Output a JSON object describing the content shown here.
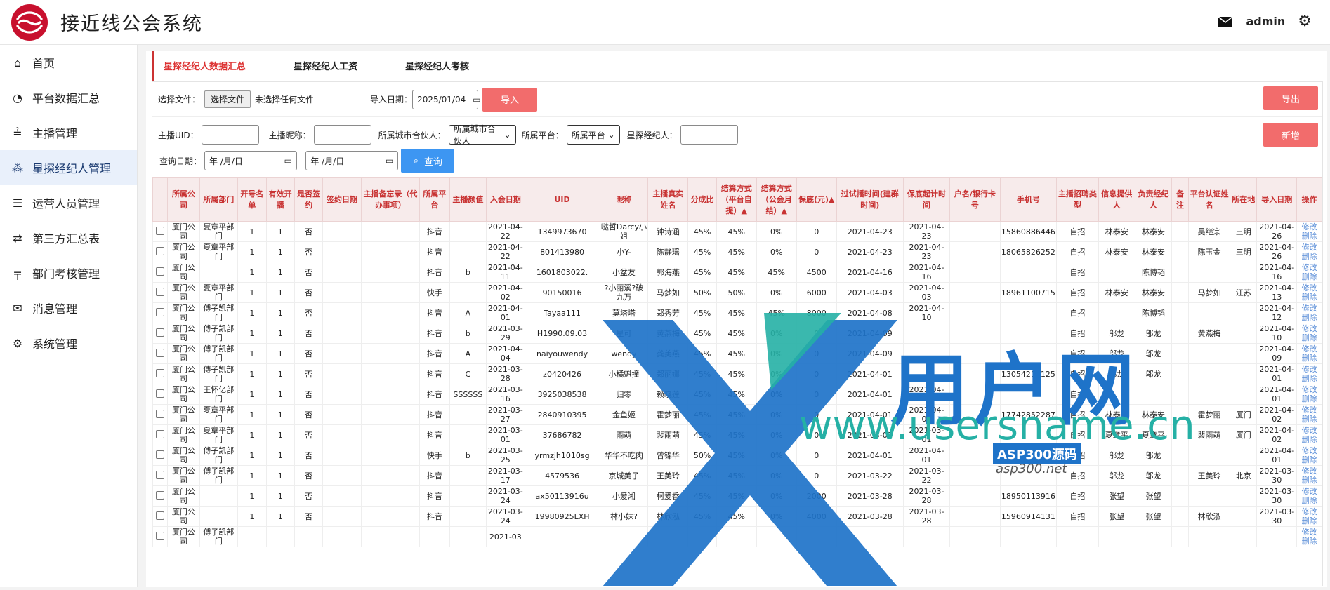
{
  "app": {
    "title": "接近线公会系统",
    "user": "admin"
  },
  "sidebar": {
    "items": [
      {
        "label": "首页",
        "icon": "home-icon",
        "glyph": "⌂"
      },
      {
        "label": "平台数据汇总",
        "icon": "dashboard-icon",
        "glyph": "◔"
      },
      {
        "label": "主播管理",
        "icon": "sliders-icon",
        "glyph": "≟"
      },
      {
        "label": "星探经纪人管理",
        "icon": "users-icon",
        "glyph": "⁂"
      },
      {
        "label": "运营人员管理",
        "icon": "list-icon",
        "glyph": "☰"
      },
      {
        "label": "第三方汇总表",
        "icon": "shuffle-icon",
        "glyph": "⇄"
      },
      {
        "label": "部门考核管理",
        "icon": "org-icon",
        "glyph": "╤"
      },
      {
        "label": "消息管理",
        "icon": "envelope-icon",
        "glyph": "✉"
      },
      {
        "label": "系统管理",
        "icon": "gear-icon",
        "glyph": "⚙"
      }
    ]
  },
  "tabs": [
    "星探经纪人数据汇总",
    "星探经纪人工资",
    "星探经纪人考核"
  ],
  "toolbar": {
    "file_label": "选择文件：",
    "file_button": "选择文件",
    "no_file": "未选择任何文件",
    "import_date_label": "导入日期：",
    "import_date": "2025/01/04",
    "import_button": "导入",
    "export_button": "导出",
    "host_uid_label": "主播UID：",
    "host_nick_label": "主播昵称：",
    "city_partner_label": "所属城市合伙人：",
    "city_partner_value": "所属城市合伙人",
    "platform_label": "所属平台：",
    "platform_value": "所属平台",
    "scout_label": "星探经纪人：",
    "add_button": "新增",
    "query_date_label": "查询日期：",
    "date_placeholder": "年 /月/日",
    "date_sep": "-",
    "query_button": "查询"
  },
  "table": {
    "headers": [
      "",
      "所属公司",
      "所属部门",
      "开号名单",
      "有效开播",
      "是否签约",
      "签约日期",
      "主播备忘录（代办事项）",
      "所属平台",
      "主播颜值",
      "入会日期",
      "UID",
      "昵称",
      "主播真实姓名",
      "分成比",
      "结算方式（平台自提）▲",
      "结算方式（公会月结）▲",
      "保底(元)▲",
      "过试播时间(建群时间)",
      "保底起计时间",
      "户名/银行卡号",
      "手机号",
      "主播招聘类型",
      "信息提供人",
      "负责经纪人",
      "备注",
      "平台认证姓名",
      "所在地",
      "导入日期",
      "操作"
    ],
    "action_edit": "修改",
    "action_delete": "删除",
    "rows": [
      [
        "厦门公司",
        "夏章平部门",
        "1",
        "1",
        "否",
        "",
        "",
        "抖音",
        "",
        "2021-04-22",
        "1349973670",
        "哒哲Darcy小姐",
        "钟诗涵",
        "45%",
        "45%",
        "0%",
        "0",
        "2021-04-23",
        "2021-04-23",
        "",
        "15860886446",
        "自招",
        "林泰安",
        "林泰安",
        "",
        "吴继宗",
        "三明",
        "2021-04-26"
      ],
      [
        "厦门公司",
        "夏章平部门",
        "1",
        "1",
        "否",
        "",
        "",
        "抖音",
        "",
        "2021-04-22",
        "801413980",
        "小Y-",
        "陈静瑶",
        "45%",
        "45%",
        "0%",
        "0",
        "2021-04-23",
        "2021-04-23",
        "",
        "18065826252",
        "自招",
        "林泰安",
        "林泰安",
        "",
        "陈玉金",
        "三明",
        "2021-04-26"
      ],
      [
        "厦门公司",
        "",
        "1",
        "1",
        "否",
        "",
        "",
        "抖音",
        "b",
        "2021-04-11",
        "1601803022.",
        "小盆友",
        "郭海燕",
        "45%",
        "45%",
        "45%",
        "4500",
        "2021-04-16",
        "2021-04-16",
        "",
        "",
        "自招",
        "",
        "陈博韬",
        "",
        "",
        "",
        "2021-04-16"
      ],
      [
        "厦门公司",
        "夏章平部门",
        "1",
        "1",
        "否",
        "",
        "",
        "快手",
        "",
        "2021-04-02",
        "90150016",
        "?小丽溪?破九万",
        "马梦如",
        "50%",
        "50%",
        "0%",
        "6000",
        "2021-04-03",
        "2021-04-03",
        "",
        "18961100715",
        "自招",
        "林泰安",
        "林泰安",
        "",
        "马梦如",
        "江苏",
        "2021-04-13"
      ],
      [
        "厦门公司",
        "傅子凯部门",
        "1",
        "1",
        "否",
        "",
        "",
        "抖音",
        "A",
        "2021-04-01",
        "Tayaa111",
        "莫塔塔",
        "郑秀芳",
        "45%",
        "45%",
        "45%",
        "8000",
        "2021-04-08",
        "2021-04-10",
        "",
        "",
        "自招",
        "",
        "陈博韬",
        "",
        "",
        "",
        "2021-04-12"
      ],
      [
        "厦门公司",
        "傅子凯部门",
        "1",
        "1",
        "否",
        "",
        "",
        "抖音",
        "b",
        "2021-03-29",
        "H1990.09.03",
        "星可",
        "黄燕梅",
        "45%",
        "45%",
        "0%",
        "0",
        "2021-04-09",
        "",
        "",
        "",
        "自招",
        "邬龙",
        "邬龙",
        "",
        "黄燕梅",
        "",
        "2021-04-10"
      ],
      [
        "厦门公司",
        "傅子凯部门",
        "1",
        "1",
        "否",
        "",
        "",
        "抖音",
        "A",
        "2021-04-04",
        "naiyouwendy",
        "wendy",
        "龚美燕",
        "45%",
        "45%",
        "0%",
        "0",
        "2021-04-09",
        "",
        "",
        "",
        "自招",
        "邬龙",
        "邬龙",
        "",
        "",
        "",
        "2021-04-09"
      ],
      [
        "厦门公司",
        "傅子凯部门",
        "1",
        "1",
        "否",
        "",
        "",
        "抖音",
        "C",
        "2021-03-28",
        "z0420426",
        "小橘魁撞",
        "郑丽娜",
        "45%",
        "45%",
        "0%",
        "0",
        "2021-04-01",
        "",
        "",
        "13054212125",
        "自招",
        "邬龙",
        "邬龙",
        "",
        "",
        "",
        "2021-04-01"
      ],
      [
        "厦门公司",
        "王怀亿部门",
        "1",
        "1",
        "否",
        "",
        "",
        "抖音",
        "SSSSSS",
        "2021-03-16",
        "3925038538",
        "归零",
        "赖晓莲",
        "45%",
        "45%",
        "0%",
        "0",
        "2021-04-01",
        "2021-04-01",
        "",
        "",
        "自招",
        "",
        "",
        "",
        "",
        "",
        "2021-04-01"
      ],
      [
        "厦门公司",
        "夏章平部门",
        "1",
        "1",
        "否",
        "",
        "",
        "抖音",
        "",
        "2021-03-27",
        "2840910395",
        "金鱼姬",
        "霍梦丽",
        "45%",
        "45%",
        "0%",
        "0",
        "2021-04-01",
        "2021-04-01",
        "",
        "17742852287",
        "自招",
        "林泰安",
        "林泰安",
        "",
        "霍梦丽",
        "厦门",
        "2021-04-02"
      ],
      [
        "厦门公司",
        "夏章平部门",
        "1",
        "1",
        "否",
        "",
        "",
        "抖音",
        "",
        "2021-03-01",
        "37686782",
        "雨萌",
        "裴雨萌",
        "45%",
        "45%",
        "0%",
        "0",
        "2021-03-01",
        "2021-03-01",
        "",
        "",
        "自招",
        "夏章平",
        "夏章平",
        "",
        "裴雨萌",
        "厦门",
        "2021-04-02"
      ],
      [
        "厦门公司",
        "傅子凯部门",
        "1",
        "1",
        "否",
        "",
        "",
        "快手",
        "b",
        "2021-03-25",
        "yrmzjh1010sg",
        "华华不吃肉",
        "曾锦华",
        "50%",
        "45%",
        "0%",
        "0",
        "2021-04-01",
        "2021-04-01",
        "",
        "",
        "自招",
        "邬龙",
        "邬龙",
        "",
        "",
        "",
        "2021-04-01"
      ],
      [
        "厦门公司",
        "傅子凯部门",
        "1",
        "1",
        "否",
        "",
        "",
        "抖音",
        "",
        "2021-03-17",
        "4579536",
        "京城美子",
        "王美玲",
        "45%",
        "45%",
        "0%",
        "0",
        "2021-03-22",
        "2021-03-22",
        "",
        "",
        "自招",
        "邬龙",
        "邬龙",
        "",
        "王美玲",
        "北京",
        "2021-03-30"
      ],
      [
        "厦门公司",
        "",
        "1",
        "1",
        "否",
        "",
        "",
        "抖音",
        "",
        "2021-03-24",
        "ax50113916u",
        "小爱湘",
        "柯爱香",
        "45%",
        "45%",
        "0%",
        "2000",
        "2021-03-28",
        "2021-03-28",
        "",
        "18950113916",
        "自招",
        "张望",
        "张望",
        "",
        "",
        "",
        "2021-03-30"
      ],
      [
        "厦门公司",
        "",
        "1",
        "1",
        "否",
        "",
        "",
        "抖音",
        "",
        "2021-03-24",
        "19980925LXH",
        "林小妹?",
        "林欣泓",
        "45%",
        "45%",
        "0%",
        "4000",
        "2021-03-28",
        "2021-03-28",
        "",
        "15960914131",
        "自招",
        "张望",
        "张望",
        "",
        "林欣泓",
        "",
        "2021-03-30"
      ],
      [
        "厦门公司",
        "傅子凯部门",
        "",
        "",
        "",
        "",
        "",
        "",
        "",
        "2021-03",
        "",
        "",
        "",
        "",
        "",
        "",
        "",
        "",
        "",
        "",
        "",
        "",
        "",
        "",
        "",
        "",
        "",
        ""
      ]
    ]
  },
  "watermark": {
    "brand": "用户网",
    "url": "www.usersname.cn",
    "badge": "ASP300源码",
    "badge_url": "asp300.net"
  },
  "colors": {
    "accent_red": "#c83232",
    "btn_red": "#f26c6c",
    "btn_blue": "#3d96f2",
    "link_blue": "#5a8ed8"
  }
}
